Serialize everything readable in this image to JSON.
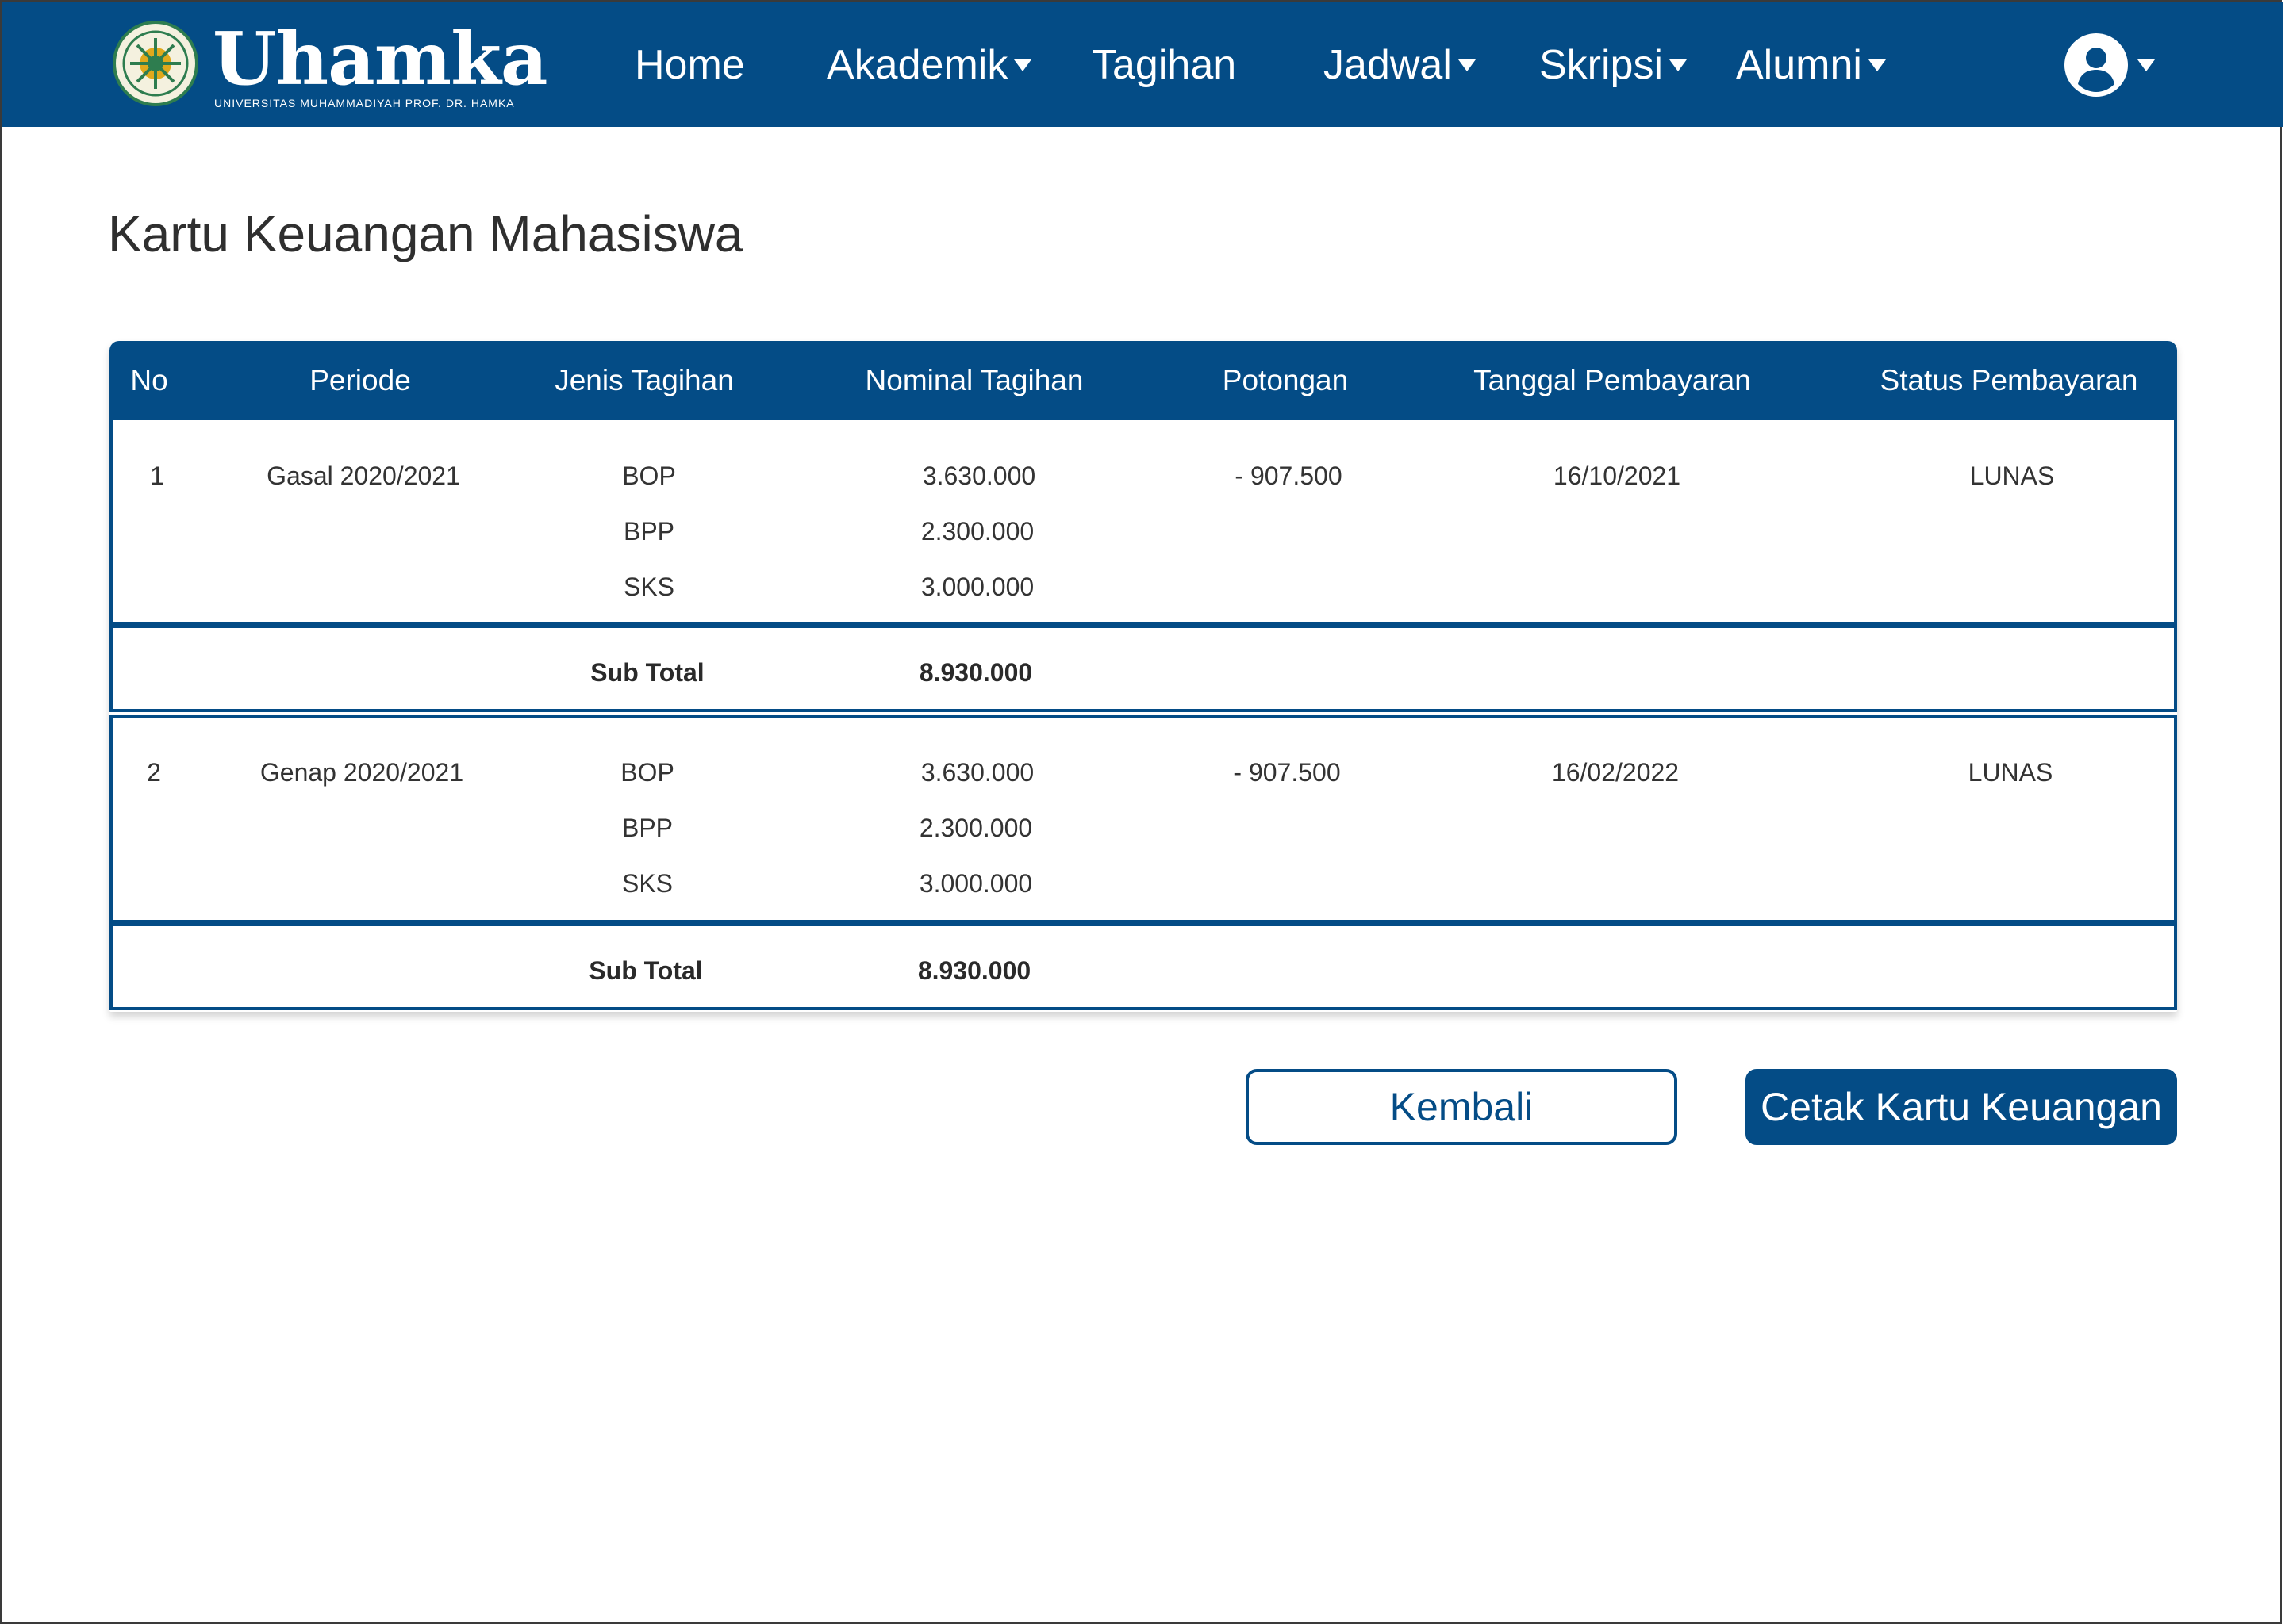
{
  "brand": {
    "name": "Uhamka",
    "subtitle": "UNIVERSITAS MUHAMMADIYAH PROF. DR. HAMKA"
  },
  "nav": {
    "items": [
      {
        "label": "Home",
        "dropdown": false
      },
      {
        "label": "Akademik",
        "dropdown": true
      },
      {
        "label": "Tagihan",
        "dropdown": false
      },
      {
        "label": "Jadwal",
        "dropdown": true
      },
      {
        "label": "Skripsi",
        "dropdown": true
      },
      {
        "label": "Alumni",
        "dropdown": true
      }
    ],
    "user_icon": "user-circle-icon"
  },
  "page": {
    "title": "Kartu Keuangan Mahasiswa"
  },
  "table": {
    "headers": [
      "No",
      "Periode",
      "Jenis Tagihan",
      "Nominal Tagihan",
      "Potongan",
      "Tanggal Pembayaran",
      "Status Pembayaran"
    ],
    "groups": [
      {
        "no": "1",
        "periode": "Gasal 2020/2021",
        "items": [
          {
            "jenis": "BOP",
            "nominal": "3.630.000"
          },
          {
            "jenis": "BPP",
            "nominal": "2.300.000"
          },
          {
            "jenis": "SKS",
            "nominal": "3.000.000"
          }
        ],
        "potongan": "- 907.500",
        "tanggal": "16/10/2021",
        "status": "LUNAS",
        "subtotal_label": "Sub Total",
        "subtotal": "8.930.000"
      },
      {
        "no": "2",
        "periode": "Genap 2020/2021",
        "items": [
          {
            "jenis": "BOP",
            "nominal": "3.630.000"
          },
          {
            "jenis": "BPP",
            "nominal": "2.300.000"
          },
          {
            "jenis": "SKS",
            "nominal": "3.000.000"
          }
        ],
        "potongan": "- 907.500",
        "tanggal": "16/02/2022",
        "status": "LUNAS",
        "subtotal_label": "Sub Total",
        "subtotal": "8.930.000"
      }
    ]
  },
  "actions": {
    "back_label": "Kembali",
    "print_label": "Cetak Kartu Keuangan"
  },
  "colors": {
    "primary": "#044c86",
    "text": "#333333",
    "background": "#ffffff"
  }
}
